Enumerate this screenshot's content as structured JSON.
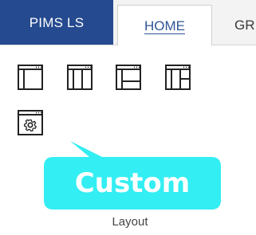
{
  "tabs": {
    "app": "PIMS LS",
    "home": "HOME",
    "next": "GR"
  },
  "callout": {
    "text": "Custom",
    "color": "#33eef2"
  },
  "layout_group": {
    "label": "Layout",
    "buttons": [
      "layout-single-icon",
      "layout-columns-icon",
      "layout-split-icon",
      "layout-grid-icon",
      "custom-layout-gear-icon"
    ]
  },
  "colors": {
    "app_tab": "#254a8f",
    "home_tab_text": "#2f5597"
  }
}
